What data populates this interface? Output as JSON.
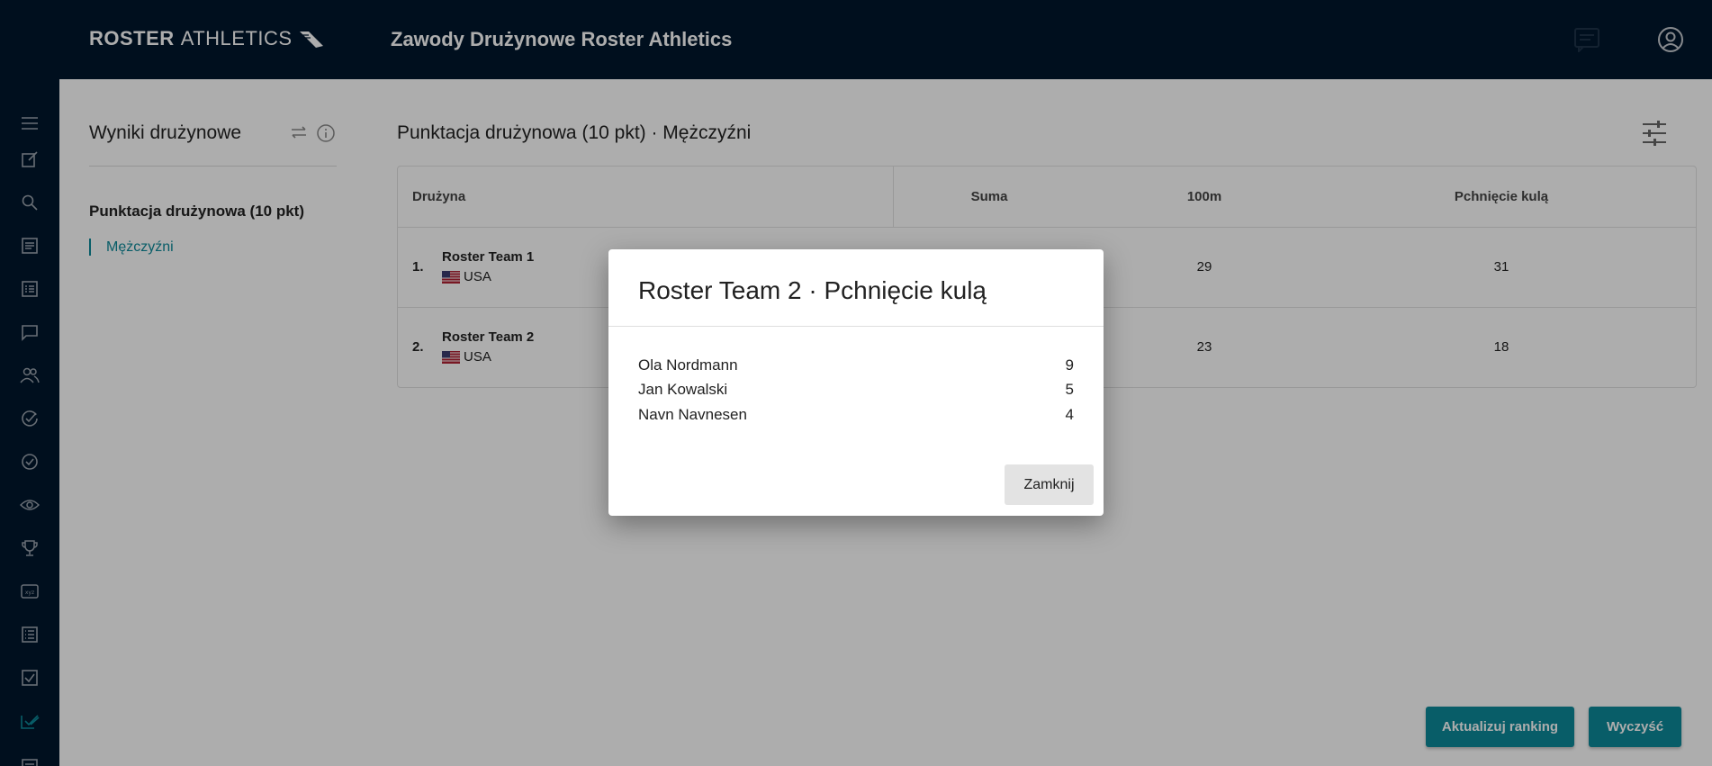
{
  "header": {
    "logo_bold": "ROSTER",
    "logo_light": "ATHLETICS",
    "title": "Zawody Drużynowe Roster Athletics"
  },
  "sidebar": {
    "title": "Wyniki drużynowe",
    "group": "Punktacja drużynowa (10 pkt)",
    "item": "Mężczyźni"
  },
  "content": {
    "title": "Punktacja drużynowa (10 pkt) · Mężczyźni",
    "columns": [
      "Drużyna",
      "Suma",
      "100m",
      "Pchnięcie kulą"
    ],
    "rows": [
      {
        "rank": "1.",
        "team": "Roster Team 1",
        "nation": "USA",
        "sum": "",
        "m100": "29",
        "shot": "31"
      },
      {
        "rank": "2.",
        "team": "Roster Team 2",
        "nation": "USA",
        "sum": "",
        "m100": "23",
        "shot": "18"
      }
    ]
  },
  "actions": {
    "update": "Aktualizuj ranking",
    "clear": "Wyczyść"
  },
  "dialog": {
    "title": "Roster Team 2 · Pchnięcie kulą",
    "entries": [
      {
        "name": "Ola Nordmann",
        "points": "9"
      },
      {
        "name": "Jan Kowalski",
        "points": "5"
      },
      {
        "name": "Navn Navnesen",
        "points": "4"
      }
    ],
    "close": "Zamknij"
  },
  "colors": {
    "navy": "#01172d",
    "accent": "#0d8a9a"
  },
  "rail_icons": [
    "menu-icon",
    "edit-icon",
    "search-icon",
    "list-icon",
    "list-alt-icon",
    "comment-icon",
    "people-icon",
    "check-circle-icon",
    "check-circle-outline-icon",
    "eye-icon",
    "trophy-icon",
    "xyz-icon",
    "list-bullets-icon",
    "checkbox-icon",
    "done-all-icon",
    "article-icon"
  ]
}
